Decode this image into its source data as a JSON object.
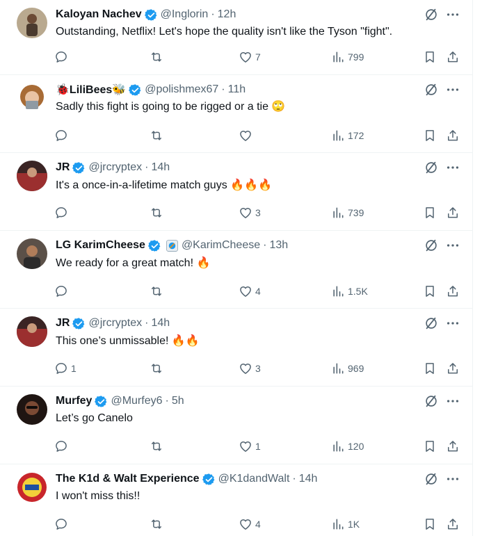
{
  "tweets": [
    {
      "name": "Kaloyan Nachev",
      "badge_extra": "",
      "handle": "@Inglorin",
      "time": "12h",
      "text": "Outstanding, Netflix! Let's hope the quality isn't like the Tyson \"fight\".",
      "fire": "",
      "replies": "",
      "likes": "7",
      "views": "799",
      "avatar_color": "#7a6b5a"
    },
    {
      "name": "🐞LiliBees🐝",
      "badge_extra": "",
      "handle": "@polishmex67",
      "time": "11h",
      "text": "Sadly this fight is going to be rigged or a tie 🙄",
      "fire": "",
      "replies": "",
      "likes": "",
      "views": "172",
      "avatar_color": "#b0703a"
    },
    {
      "name": "JR",
      "badge_extra": "",
      "handle": "@jrcryptex",
      "time": "14h",
      "text": "It's a once-in-a-lifetime match guys ",
      "fire": "🔥🔥🔥",
      "replies": "",
      "likes": "3",
      "views": "739",
      "avatar_color": "#8b2b2b"
    },
    {
      "name": "LG KarimCheese",
      "badge_extra": "square",
      "handle": "@KarimCheese",
      "time": "13h",
      "text": "We ready for a great match! ",
      "fire": "🔥",
      "replies": "",
      "likes": "4",
      "views": "1.5K",
      "avatar_color": "#3b3028"
    },
    {
      "name": "JR",
      "badge_extra": "",
      "handle": "@jrcryptex",
      "time": "14h",
      "text": "This one’s unmissable! ",
      "fire": "🔥🔥",
      "replies": "1",
      "likes": "3",
      "views": "969",
      "avatar_color": "#8b2b2b"
    },
    {
      "name": "Murfey",
      "badge_extra": "",
      "handle": "@Murfey6",
      "time": "5h",
      "text": "Let’s go Canelo",
      "fire": "",
      "replies": "",
      "likes": "1",
      "views": "120",
      "avatar_color": "#2a1d18"
    },
    {
      "name": "The K1d & Walt Experience",
      "badge_extra": "",
      "handle": "@K1dandWalt",
      "time": "14h",
      "text": "I won't miss this!!",
      "fire": "",
      "replies": "",
      "likes": "4",
      "views": "1K",
      "avatar_color": "#c8262b"
    }
  ],
  "colors": {
    "verified": "#1d9bf0",
    "secondary": "#536471",
    "text": "#0f1419"
  }
}
